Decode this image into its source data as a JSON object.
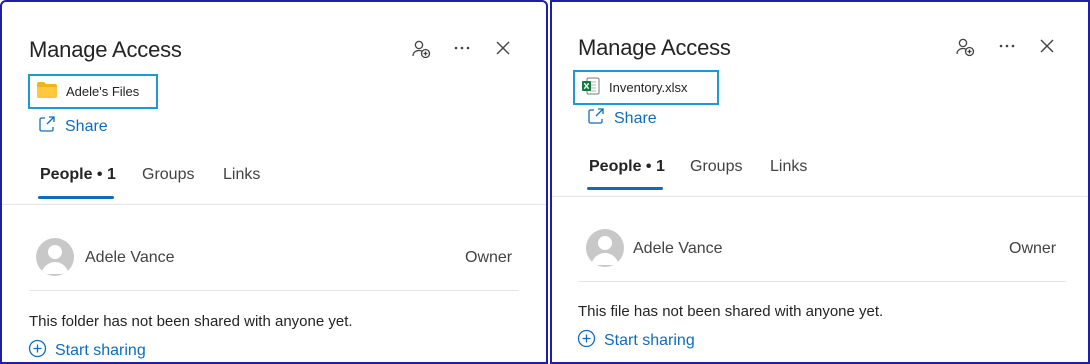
{
  "left": {
    "title": "Manage Access",
    "item_name": "Adele's Files",
    "share_label": "Share",
    "tabs": [
      {
        "label": "People • 1"
      },
      {
        "label": "Groups"
      },
      {
        "label": "Links"
      }
    ],
    "person_name": "Adele Vance",
    "person_role": "Owner",
    "info_text": "This folder has not been shared with anyone yet.",
    "start_label": "Start sharing"
  },
  "right": {
    "title": "Manage Access",
    "item_name": "Inventory.xlsx",
    "share_label": "Share",
    "tabs": [
      {
        "label": "People • 1"
      },
      {
        "label": "Groups"
      },
      {
        "label": "Links"
      }
    ],
    "person_name": "Adele Vance",
    "person_role": "Owner",
    "info_text": "This file has not been shared with anyone yet.",
    "start_label": "Start sharing"
  },
  "colors": {
    "accent": "#0f6cbd",
    "highlight_box": "#1c9ad6",
    "panel_border": "#1f1fa3",
    "folder": "#f2b320",
    "excel": "#107c41"
  },
  "icons": [
    "add-person-icon",
    "more-icon",
    "close-icon",
    "folder-icon",
    "excel-file-icon",
    "share-icon",
    "add-circle-icon",
    "person-avatar-icon"
  ]
}
